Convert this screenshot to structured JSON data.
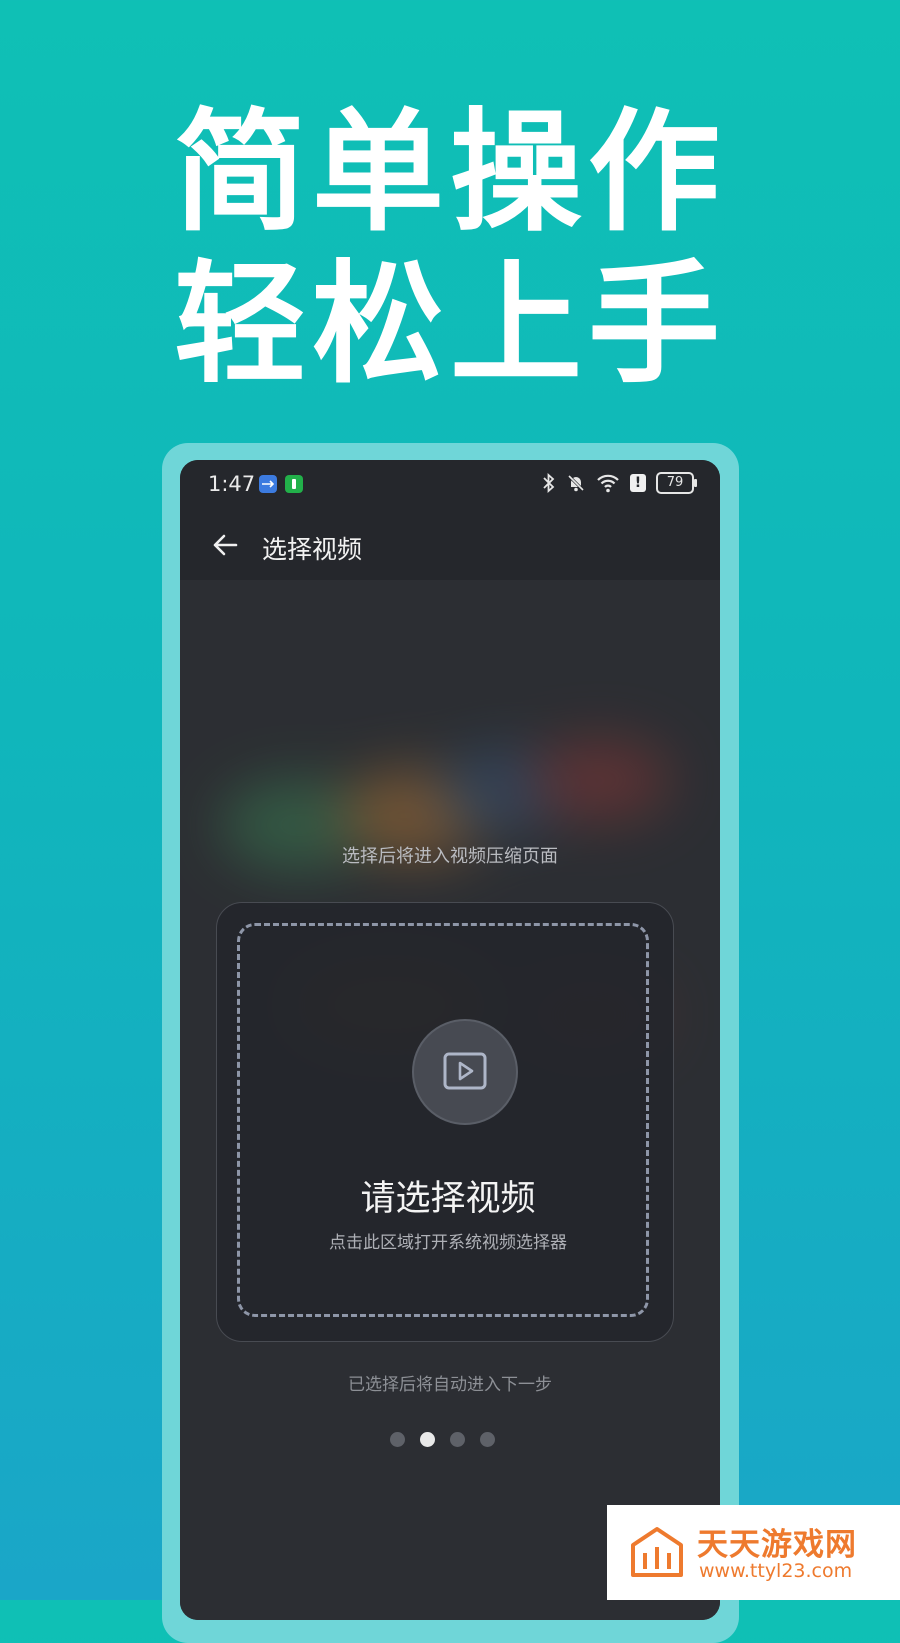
{
  "promo": {
    "line1": "简单操作",
    "line2": "轻松上手"
  },
  "status_bar": {
    "time": "1:47",
    "battery": "79",
    "icons": [
      "usb-icon",
      "battery-notification-icon",
      "bluetooth-icon",
      "bell-off-icon",
      "wifi-icon",
      "alert-icon",
      "battery-icon"
    ]
  },
  "app_bar": {
    "title": "选择视频",
    "back_icon": "arrow-left-icon"
  },
  "picker": {
    "hint_top": "选择后将进入视频压缩页面",
    "title": "请选择视频",
    "subtitle": "点击此区域打开系统视频选择器",
    "hint_bottom": "已选择后将自动进入下一步",
    "icon": "video-play-icon"
  },
  "pagination": {
    "total": 4,
    "active_index": 1
  },
  "watermark": {
    "title": "天天游戏网",
    "url": "www.ttyl23.com"
  },
  "colors": {
    "brand_teal": "#0fc0b5",
    "phone_bg": "#25272c",
    "watermark_orange": "#ee7a2e"
  }
}
